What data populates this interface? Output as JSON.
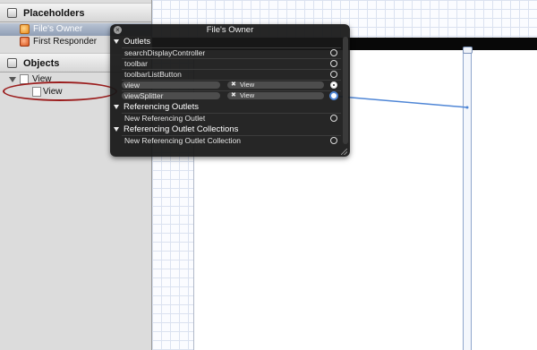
{
  "outline": {
    "placeholders_header": "Placeholders",
    "placeholders": [
      {
        "label": "File's Owner",
        "icon": "files-owner-cube-icon",
        "selected": true
      },
      {
        "label": "First Responder",
        "icon": "first-responder-cube-icon",
        "selected": false
      }
    ],
    "objects_header": "Objects",
    "tree": [
      {
        "label": "View",
        "expanded": true
      },
      {
        "label": "View"
      }
    ]
  },
  "hud": {
    "title": "File's Owner",
    "close_icon": "close-icon",
    "sections": {
      "outlets": "Outlets",
      "referencing_outlets": "Referencing Outlets",
      "referencing_outlet_collections": "Referencing Outlet Collections"
    },
    "outlets": [
      {
        "name": "searchDisplayController",
        "connected": false
      },
      {
        "name": "toolbar",
        "connected": false
      },
      {
        "name": "toolbarListButton",
        "connected": false
      },
      {
        "name": "view",
        "connected": true,
        "target": "View"
      },
      {
        "name": "viewSplitter",
        "connected": true,
        "target": "View",
        "active": true
      }
    ],
    "referencing_outlets": [
      {
        "name": "New Referencing Outlet"
      }
    ],
    "referencing_outlet_collections": [
      {
        "name": "New Referencing Outlet Collection"
      }
    ]
  },
  "colors": {
    "hud_background": "#181818",
    "connection_blue": "#4f86d6",
    "annotation_red": "#9b1d1d",
    "selection": "#8f9eb5"
  }
}
